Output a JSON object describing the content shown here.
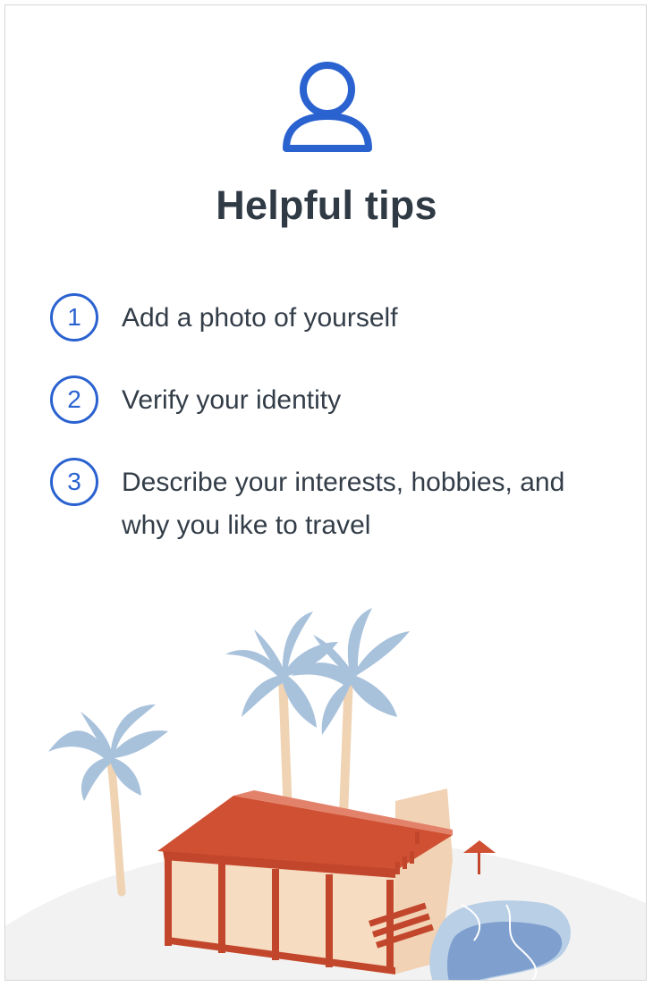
{
  "page": {
    "title": "Helpful tips"
  },
  "tips": [
    {
      "number": "1",
      "text": "Add a photo of yourself"
    },
    {
      "number": "2",
      "text": "Verify your identity"
    },
    {
      "number": "3",
      "text": "Describe your interests, hobbies, and why you like to travel"
    }
  ],
  "icons": {
    "header": "person-icon",
    "illustration": "beach-house-palms-illustration"
  },
  "colors": {
    "accent": "#2a62d0",
    "title": "#2f3a45",
    "body_text": "#333d48",
    "roof": "#cf5032",
    "house_wall": "#f1d2b4",
    "palm_leaves": "#a9c2dc",
    "palm_trunk": "#efd3b3",
    "pool": "#7f9fce",
    "ground": "#f2f2f2"
  }
}
